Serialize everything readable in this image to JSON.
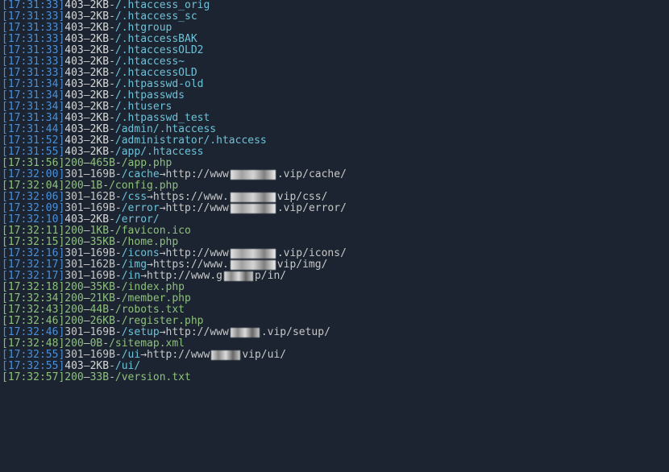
{
  "lines": [
    {
      "time": "[17:31:33]",
      "timeClass": "time",
      "status": "403",
      "statusClass": "status-403",
      "size": "2KB",
      "sizeClass": "size-403",
      "path": "/.htaccess_orig",
      "pathClass": "path-cyan"
    },
    {
      "time": "[17:31:33]",
      "timeClass": "time",
      "status": "403",
      "statusClass": "status-403",
      "size": "2KB",
      "sizeClass": "size-403",
      "path": "/.htaccess_sc",
      "pathClass": "path-cyan"
    },
    {
      "time": "[17:31:33]",
      "timeClass": "time",
      "status": "403",
      "statusClass": "status-403",
      "size": "2KB",
      "sizeClass": "size-403",
      "path": "/.htgroup",
      "pathClass": "path-cyan"
    },
    {
      "time": "[17:31:33]",
      "timeClass": "time",
      "status": "403",
      "statusClass": "status-403",
      "size": "2KB",
      "sizeClass": "size-403",
      "path": "/.htaccessBAK",
      "pathClass": "path-cyan"
    },
    {
      "time": "[17:31:33]",
      "timeClass": "time",
      "status": "403",
      "statusClass": "status-403",
      "size": "2KB",
      "sizeClass": "size-403",
      "path": "/.htaccessOLD2",
      "pathClass": "path-cyan"
    },
    {
      "time": "[17:31:33]",
      "timeClass": "time",
      "status": "403",
      "statusClass": "status-403",
      "size": "2KB",
      "sizeClass": "size-403",
      "path": "/.htaccess~",
      "pathClass": "path-cyan"
    },
    {
      "time": "[17:31:33]",
      "timeClass": "time",
      "status": "403",
      "statusClass": "status-403",
      "size": "2KB",
      "sizeClass": "size-403",
      "path": "/.htaccessOLD",
      "pathClass": "path-cyan"
    },
    {
      "time": "[17:31:34]",
      "timeClass": "time",
      "status": "403",
      "statusClass": "status-403",
      "size": "2KB",
      "sizeClass": "size-403",
      "path": "/.htpasswd-old",
      "pathClass": "path-cyan"
    },
    {
      "time": "[17:31:34]",
      "timeClass": "time",
      "status": "403",
      "statusClass": "status-403",
      "size": "2KB",
      "sizeClass": "size-403",
      "path": "/.htpasswds",
      "pathClass": "path-cyan"
    },
    {
      "time": "[17:31:34]",
      "timeClass": "time",
      "status": "403",
      "statusClass": "status-403",
      "size": "2KB",
      "sizeClass": "size-403",
      "path": "/.htusers",
      "pathClass": "path-cyan"
    },
    {
      "time": "[17:31:34]",
      "timeClass": "time",
      "status": "403",
      "statusClass": "status-403",
      "size": "2KB",
      "sizeClass": "size-403",
      "path": "/.htpasswd_test",
      "pathClass": "path-cyan"
    },
    {
      "time": "[17:31:44]",
      "timeClass": "time",
      "status": "403",
      "statusClass": "status-403",
      "size": "2KB",
      "sizeClass": "size-403",
      "path": "/admin/.htaccess",
      "pathClass": "path-cyan"
    },
    {
      "time": "[17:31:52]",
      "timeClass": "time",
      "status": "403",
      "statusClass": "status-403",
      "size": "2KB",
      "sizeClass": "size-403",
      "path": "/administrator/.htaccess",
      "pathClass": "path-cyan"
    },
    {
      "time": "[17:31:55]",
      "timeClass": "time",
      "status": "403",
      "statusClass": "status-403",
      "size": "2KB",
      "sizeClass": "size-403",
      "path": "/app/.htaccess",
      "pathClass": "path-cyan"
    },
    {
      "time": "[17:31:56]",
      "timeClass": "time-green",
      "status": "200",
      "statusClass": "status-200",
      "size": "465B",
      "sizeClass": "size-200",
      "path": "/app.php",
      "pathClass": "path-green"
    },
    {
      "time": "[17:32:00]",
      "timeClass": "time",
      "status": "301",
      "statusClass": "status-301",
      "size": "169B",
      "sizeClass": "size-301",
      "path": "/cache",
      "pathClass": "path-cyan",
      "redirect": {
        "arrow": "→",
        "pre": "http://www",
        "blur": "blur",
        "post": ".vip/cache/"
      }
    },
    {
      "time": "[17:32:04]",
      "timeClass": "time-green",
      "status": "200",
      "statusClass": "status-200",
      "size": "1B",
      "sizeClass": "size-200",
      "path": "/config.php",
      "pathClass": "path-green"
    },
    {
      "time": "[17:32:06]",
      "timeClass": "time",
      "status": "301",
      "statusClass": "status-301",
      "size": "162B",
      "sizeClass": "size-301",
      "path": "/css",
      "pathClass": "path-cyan",
      "redirect": {
        "arrow": "→",
        "pre": "https://www.",
        "blur": "blur",
        "post": "vip/css/"
      }
    },
    {
      "time": "[17:32:09]",
      "timeClass": "time",
      "status": "301",
      "statusClass": "status-301",
      "size": "169B",
      "sizeClass": "size-301",
      "path": "/error",
      "pathClass": "path-cyan",
      "redirect": {
        "arrow": "→",
        "pre": "http://www",
        "blur": "blur",
        "post": ".vip/error/"
      }
    },
    {
      "time": "[17:32:10]",
      "timeClass": "time",
      "status": "403",
      "statusClass": "status-403",
      "size": "2KB",
      "sizeClass": "size-403",
      "path": "/error/",
      "pathClass": "path-cyan"
    },
    {
      "time": "[17:32:11]",
      "timeClass": "time-green",
      "status": "200",
      "statusClass": "status-200",
      "size": "1KB",
      "sizeClass": "size-200",
      "path": "/favicon.ico",
      "pathClass": "path-green"
    },
    {
      "time": "[17:32:15]",
      "timeClass": "time-green",
      "status": "200",
      "statusClass": "status-200",
      "size": "35KB",
      "sizeClass": "size-200",
      "path": "/home.php",
      "pathClass": "path-green"
    },
    {
      "time": "[17:32:16]",
      "timeClass": "time",
      "status": "301",
      "statusClass": "status-301",
      "size": "169B",
      "sizeClass": "size-301",
      "path": "/icons",
      "pathClass": "path-cyan",
      "redirect": {
        "arrow": "→",
        "pre": "http://www",
        "blur": "blur",
        "post": ".vip/icons/"
      }
    },
    {
      "time": "[17:32:17]",
      "timeClass": "time",
      "status": "301",
      "statusClass": "status-301",
      "size": "162B",
      "sizeClass": "size-301",
      "path": "/img",
      "pathClass": "path-cyan",
      "redirect": {
        "arrow": "→",
        "pre": "https://www.",
        "blur": "blur",
        "post": "vip/img/"
      }
    },
    {
      "time": "[17:32:17]",
      "timeClass": "time",
      "status": "301",
      "statusClass": "status-301",
      "size": "169B",
      "sizeClass": "size-301",
      "path": "/in",
      "pathClass": "path-cyan",
      "redirect": {
        "arrow": "→",
        "pre": "http://www.g",
        "blur": "blur2",
        "post": "p/in/"
      }
    },
    {
      "time": "[17:32:18]",
      "timeClass": "time-green",
      "status": "200",
      "statusClass": "status-200",
      "size": "35KB",
      "sizeClass": "size-200",
      "path": "/index.php",
      "pathClass": "path-green"
    },
    {
      "time": "[17:32:34]",
      "timeClass": "time-green",
      "status": "200",
      "statusClass": "status-200",
      "size": "21KB",
      "sizeClass": "size-200",
      "path": "/member.php",
      "pathClass": "path-green"
    },
    {
      "time": "[17:32:43]",
      "timeClass": "time-green",
      "status": "200",
      "statusClass": "status-200",
      "size": "44B",
      "sizeClass": "size-200",
      "path": "/robots.txt",
      "pathClass": "path-green"
    },
    {
      "time": "[17:32:46]",
      "timeClass": "time-green",
      "status": "200",
      "statusClass": "status-200",
      "size": "26KB",
      "sizeClass": "size-200",
      "path": "/register.php",
      "pathClass": "path-green"
    },
    {
      "time": "[17:32:46]",
      "timeClass": "time",
      "status": "301",
      "statusClass": "status-301",
      "size": "169B",
      "sizeClass": "size-301",
      "path": "/setup",
      "pathClass": "path-cyan",
      "redirect": {
        "arrow": "→",
        "pre": "http://www",
        "blur": "blur2",
        "post": ".vip/setup/"
      }
    },
    {
      "time": "[17:32:48]",
      "timeClass": "time-green",
      "status": "200",
      "statusClass": "status-200",
      "size": "0B",
      "sizeClass": "size-200",
      "path": "/sitemap.xml",
      "pathClass": "path-green"
    },
    {
      "time": "[17:32:55]",
      "timeClass": "time",
      "status": "301",
      "statusClass": "status-301",
      "size": "169B",
      "sizeClass": "size-301",
      "path": "/ui",
      "pathClass": "path-cyan",
      "redirect": {
        "arrow": "→",
        "pre": "http://www",
        "blur": "blur2",
        "post": "vip/ui/"
      }
    },
    {
      "time": "[17:32:55]",
      "timeClass": "time",
      "status": "403",
      "statusClass": "status-403",
      "size": "2KB",
      "sizeClass": "size-403",
      "path": "/ui/",
      "pathClass": "path-cyan"
    },
    {
      "time": "[17:32:57]",
      "timeClass": "time-green",
      "status": "200",
      "statusClass": "status-200",
      "size": "33B",
      "sizeClass": "size-200",
      "path": "/version.txt",
      "pathClass": "path-green"
    }
  ],
  "dash": "-",
  "dashThin": "–"
}
